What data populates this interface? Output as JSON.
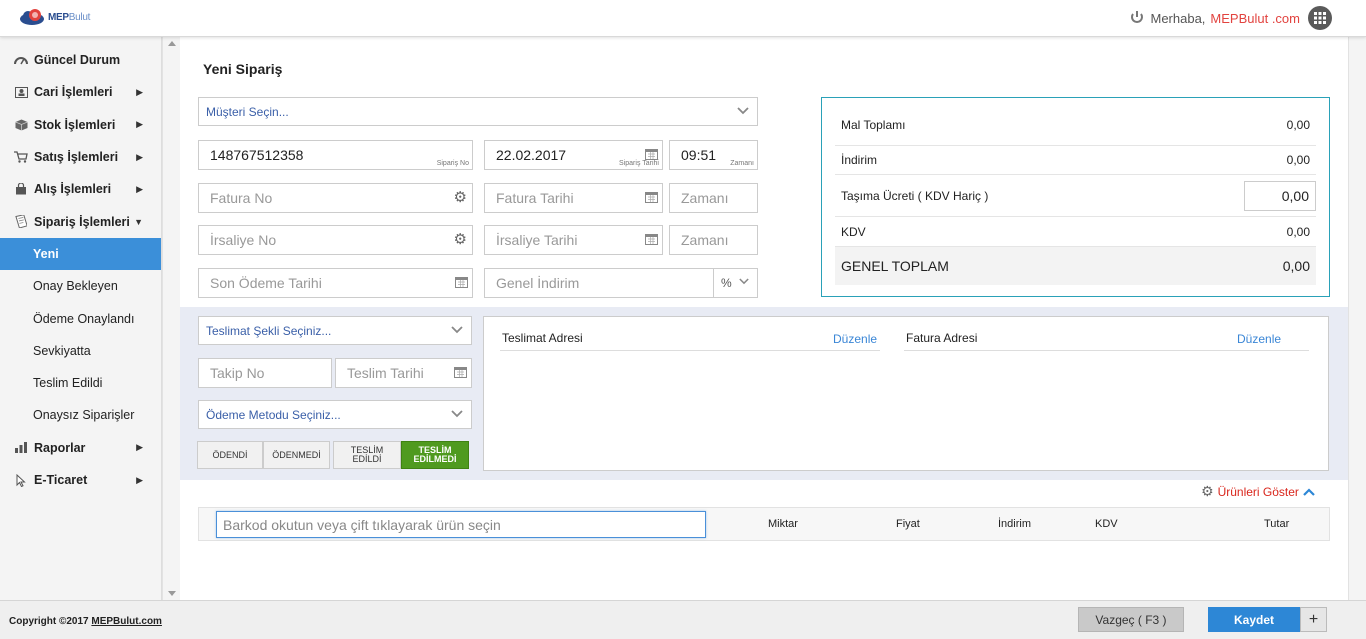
{
  "header": {
    "logo_brand": "MEP",
    "logo_brand_suffix": "Bulut",
    "greeting": "Merhaba,",
    "user": "MEPBulut .com"
  },
  "sidebar": {
    "items": [
      {
        "label": "Güncel Durum",
        "icon": "dashboard-icon"
      },
      {
        "label": "Cari İşlemleri",
        "icon": "contact-card-icon"
      },
      {
        "label": "Stok İşlemleri",
        "icon": "box-icon"
      },
      {
        "label": "Satış İşlemleri",
        "icon": "cart-icon"
      },
      {
        "label": "Alış İşlemleri",
        "icon": "bag-icon"
      },
      {
        "label": "Sipariş İşlemleri",
        "icon": "document-icon"
      }
    ],
    "sub_items": [
      "Yeni",
      "Onay Bekleyen",
      "Ödeme Onaylandı",
      "Sevkiyatta",
      "Teslim Edildi",
      "Onaysız Siparişler"
    ],
    "bottom_items": [
      {
        "label": "Raporlar",
        "icon": "bar-chart-icon"
      },
      {
        "label": "E-Ticaret",
        "icon": "cursor-icon"
      }
    ]
  },
  "page": {
    "title": "Yeni Sipariş",
    "customer_select": "Müşteri Seçin...",
    "order_no": "148767512358",
    "order_no_label": "Sipariş No",
    "order_date": "22.02.2017",
    "order_date_label": "Sipariş Tarihi",
    "order_time": "09:51",
    "time_label": "Zamanı",
    "invoice_no_ph": "Fatura No",
    "invoice_date_ph": "Fatura Tarihi",
    "invoice_time_ph": "Zamanı",
    "waybill_no_ph": "İrsaliye No",
    "waybill_date_ph": "İrsaliye Tarihi",
    "waybill_time_ph": "Zamanı",
    "due_date_ph": "Son Ödeme Tarihi",
    "general_discount_ph": "Genel İndirim",
    "discount_unit": "%"
  },
  "summary": {
    "goods_total_label": "Mal Toplamı",
    "goods_total": "0,00",
    "discount_label": "İndirim",
    "discount": "0,00",
    "shipping_label": "Taşıma Ücreti ( KDV Hariç )",
    "shipping": "0,00",
    "vat_label": "KDV",
    "vat": "0,00",
    "grand_total_label": "GENEL TOPLAM",
    "grand_total": "0,00"
  },
  "delivery": {
    "method_select": "Teslimat Şekli Seçiniz...",
    "tracking_ph": "Takip No",
    "delivery_date_ph": "Teslim Tarihi",
    "payment_select": "Ödeme Metodu Seçiniz...",
    "status_buttons": [
      "ÖDENDİ",
      "ÖDENMEDİ",
      "TESLİM EDİLDİ",
      "TESLİM EDİLMEDİ"
    ],
    "shipping_address_label": "Teslimat Adresi",
    "billing_address_label": "Fatura Adresi",
    "edit_label": "Düzenle"
  },
  "products": {
    "show_label": "Ürünleri Göster",
    "barcode_ph": "Barkod okutun veya çift tıklayarak ürün seçin",
    "columns": [
      "Miktar",
      "Fiyat",
      "İndirim",
      "KDV",
      "Tutar"
    ]
  },
  "footer": {
    "copyright": "Copyright ©2017",
    "copyright_link": "MEPBulut.com",
    "cancel_label": "Vazgeç ( F3 )",
    "save_label": "Kaydet",
    "plus_label": "+"
  },
  "colors": {
    "accent": "#3b8fd9",
    "active_status": "#4f9a1f",
    "summary_border": "#2aa1b8",
    "user_name": "#e2433f"
  }
}
